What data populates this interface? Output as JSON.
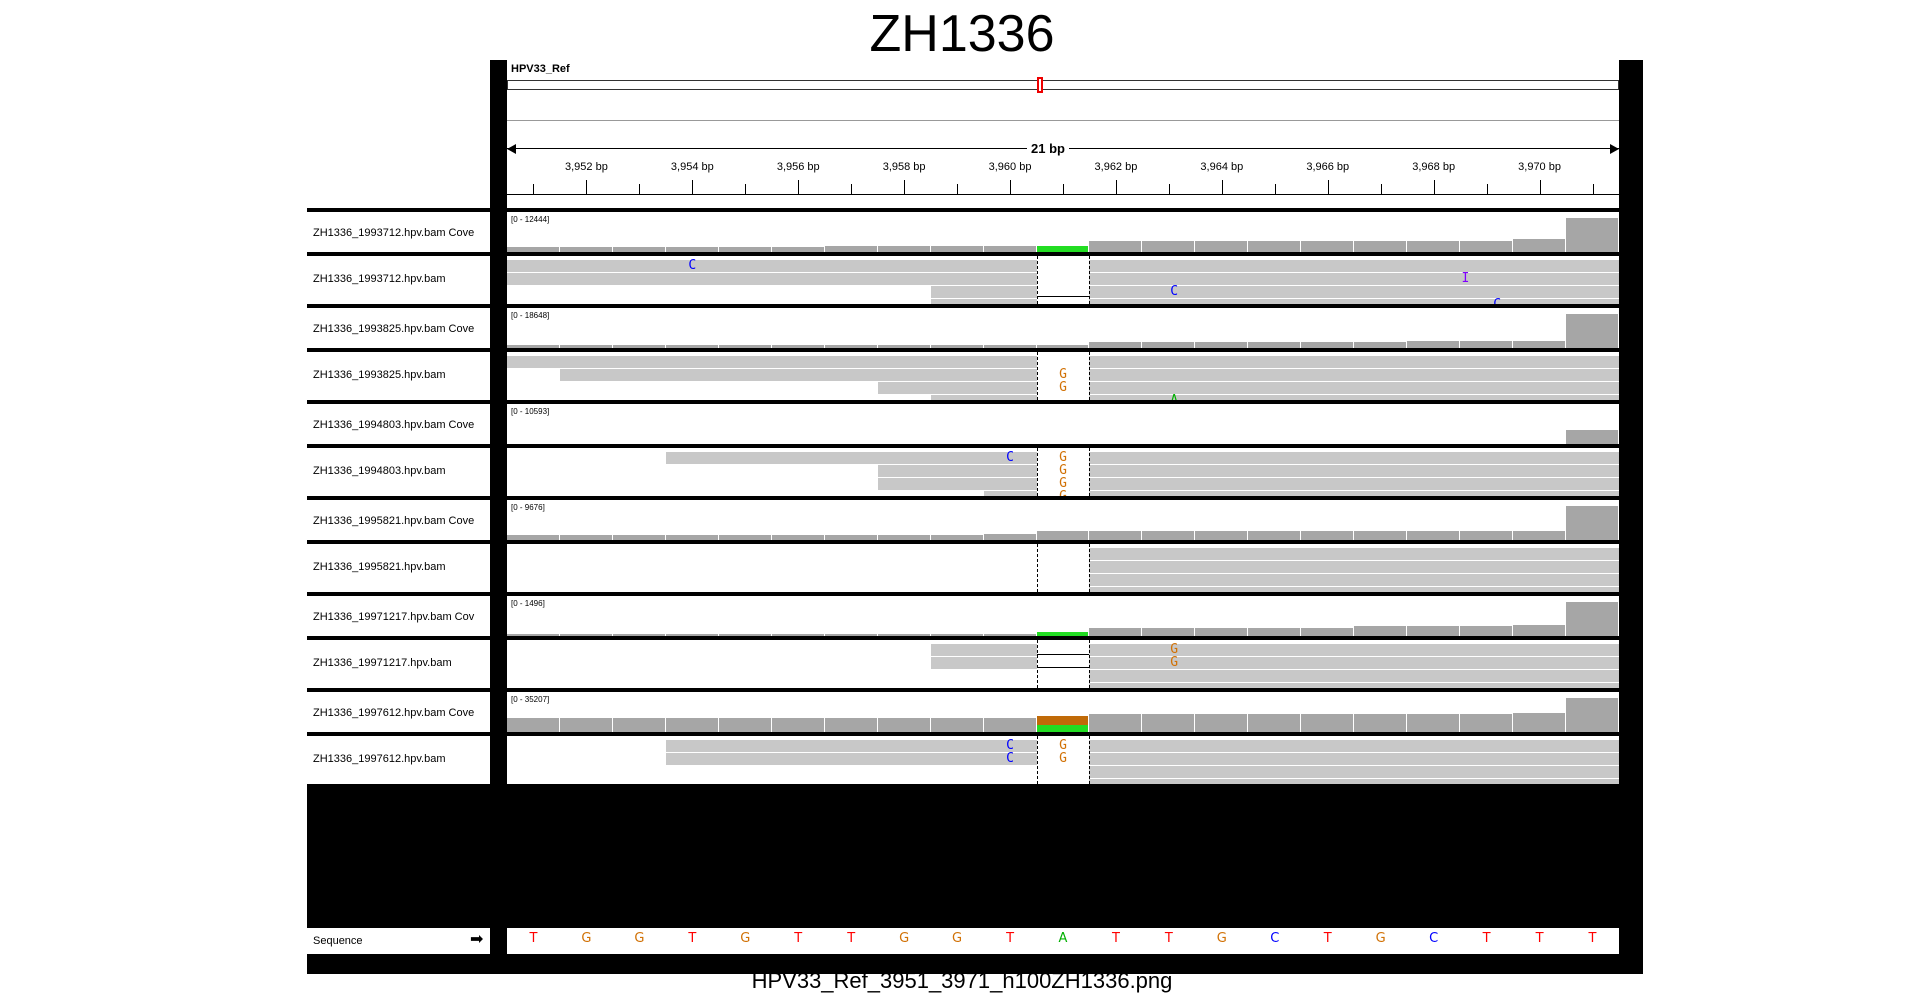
{
  "title": "ZH1336",
  "caption": "HPV33_Ref_3951_3971_h100ZH1336.png",
  "ruler": {
    "name": "HPV33_Ref",
    "span": "21 bp",
    "ticks": [
      "3,952 bp",
      "3,954 bp",
      "3,956 bp",
      "3,958 bp",
      "3,960 bp",
      "3,962 bp",
      "3,964 bp",
      "3,966 bp",
      "3,968 bp",
      "3,970 bp"
    ]
  },
  "samples": [
    {
      "cov_name": "ZH1336_1993712.hpv.bam Cove",
      "cov_range": "[0 - 12444]",
      "bam_name": "ZH1336_1993712.hpv.bam"
    },
    {
      "cov_name": "ZH1336_1993825.hpv.bam Cove",
      "cov_range": "[0 - 18648]",
      "bam_name": "ZH1336_1993825.hpv.bam"
    },
    {
      "cov_name": "ZH1336_1994803.hpv.bam Cove",
      "cov_range": "[0 - 10593]",
      "bam_name": "ZH1336_1994803.hpv.bam"
    },
    {
      "cov_name": "ZH1336_1995821.hpv.bam Cove",
      "cov_range": "[0 - 9676]",
      "bam_name": "ZH1336_1995821.hpv.bam"
    },
    {
      "cov_name": "ZH1336_19971217.hpv.bam Cov",
      "cov_range": "[0 - 1496]",
      "bam_name": "ZH1336_19971217.hpv.bam"
    },
    {
      "cov_name": "ZH1336_1997612.hpv.bam Cove",
      "cov_range": "[0 - 35207]",
      "bam_name": "ZH1336_1997612.hpv.bam"
    }
  ],
  "sequence": {
    "label": "Sequence",
    "arrow": "➡",
    "bases": [
      "T",
      "G",
      "G",
      "T",
      "G",
      "T",
      "T",
      "G",
      "G",
      "T",
      "A",
      "T",
      "T",
      "G",
      "C",
      "T",
      "G",
      "C",
      "T",
      "T",
      "T"
    ]
  },
  "colors": {
    "A": "#00b000",
    "C": "#0000ff",
    "G": "#d17105",
    "T": "#ff0000",
    "I": "#8000ff"
  },
  "mismatch_labels": [
    [
      "C",
      "C",
      "I",
      "C"
    ],
    [
      "G",
      "G",
      "A"
    ],
    [
      "C",
      "G",
      "G",
      "G",
      "G"
    ],
    [],
    [
      "G",
      "G"
    ],
    [
      "C",
      "C",
      "G",
      "G"
    ]
  ]
}
